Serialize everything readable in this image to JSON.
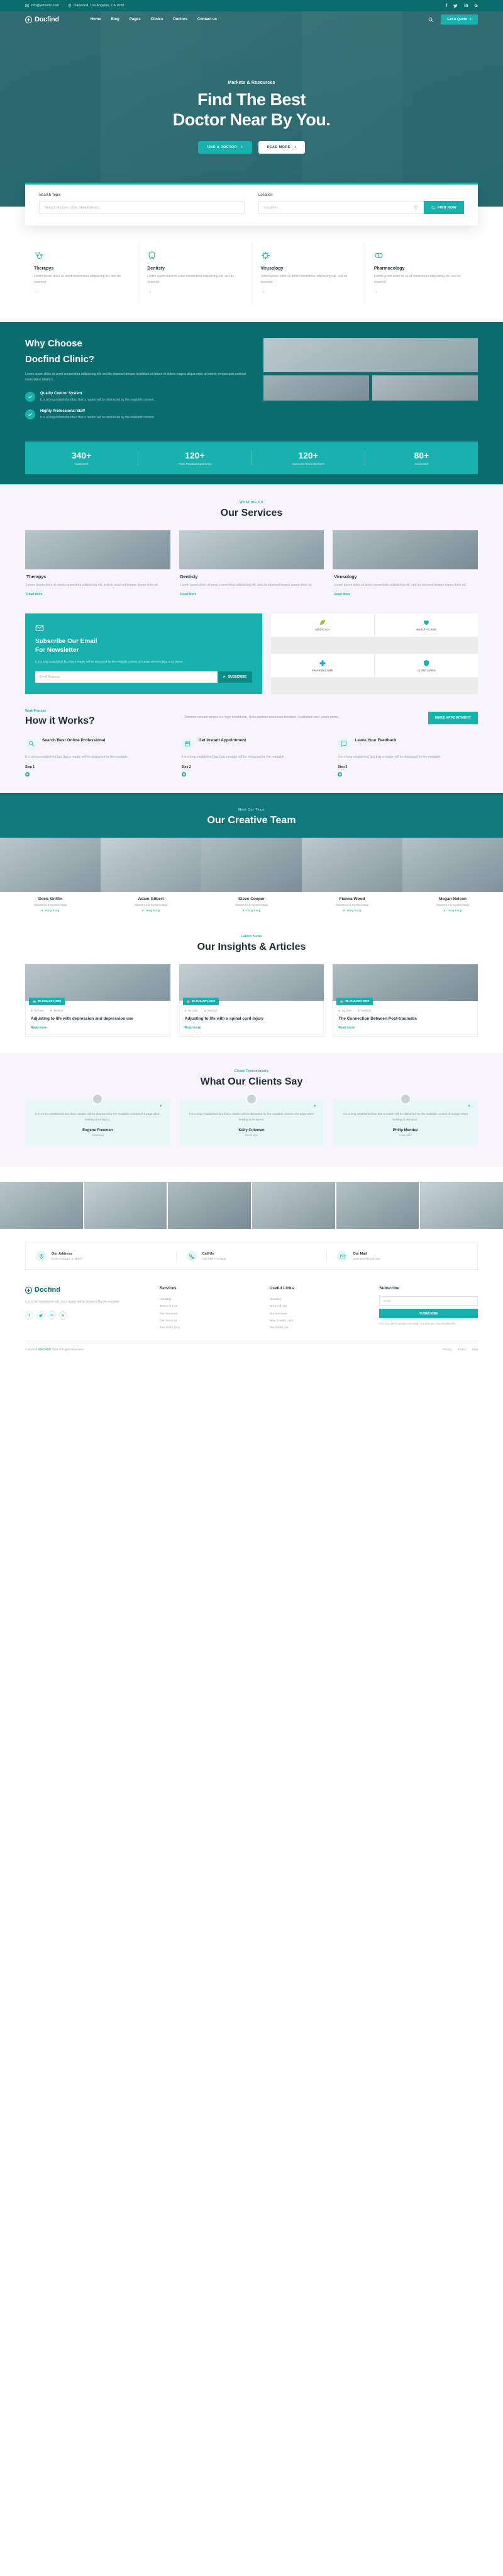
{
  "topbar": {
    "email": "info@website.com",
    "location": "Oakwood, Los Angeles, CA 1098",
    "social": [
      "f",
      "ƒ",
      "in",
      "G"
    ]
  },
  "nav": {
    "logo": "Docfind",
    "items": [
      "Home",
      "Blog",
      "Pages",
      "Clinics",
      "Doctors",
      "Contact us"
    ],
    "quote_label": "Get A Quote"
  },
  "hero": {
    "eyebrow": "Markets & Resources",
    "title_line1": "Find The Best",
    "title_line2": "Doctor Near By You.",
    "btn_primary": "FIND A DOCTOR",
    "btn_secondary": "READ MORE"
  },
  "search": {
    "label_topic": "Search Topic",
    "label_location": "Location",
    "placeholder_topic": "Search doctors, clinic, Hospitals etc.",
    "placeholder_location": "Location",
    "button": "FIND NOW"
  },
  "service_icons": [
    {
      "title": "Therapys",
      "desc": "Lorem ipsum dolor sit amet consectetur adipisicing elit, sed do eiusmod"
    },
    {
      "title": "Dentisty",
      "desc": "Lorem ipsum dolor sit amet consectetur adipisicing elit, sed do eiusmod"
    },
    {
      "title": "Virusology",
      "desc": "Lorem ipsum dolor sit amet consectetur adipisicing elit, sed do eiusmod"
    },
    {
      "title": "Pharmocology",
      "desc": "Lorem ipsum dolor sit amet consectetur adipisicing elit, sed do eiusmod"
    }
  ],
  "why": {
    "title_line1": "Why Choose",
    "title_line2": "Docfind Clinic?",
    "paragraph": "Lorem ipsum dolor sit amet consectetur adipisicing elit, sed do eiusmod tempor incididunt ut labore et dolore magna aliqua enim ad minim veniam quis nostrud exercitation ullamco.",
    "features": [
      {
        "title": "Quality Control System",
        "desc": "It is a long established fact that a reader will be distracted by the readable content."
      },
      {
        "title": "Highly Professional Staff",
        "desc": "It is a long established fact that a reader will be distracted by the readable content."
      }
    ]
  },
  "stats": [
    {
      "number": "340+",
      "label": "Customers"
    },
    {
      "number": "120+",
      "label": "Years Practical Experience"
    },
    {
      "number": "120+",
      "label": "Awesome Team Members"
    },
    {
      "number": "80+",
      "label": "Customers"
    }
  ],
  "services": {
    "eyebrow": "WHAT WE DO",
    "title": "Our Services",
    "cards": [
      {
        "title": "Therapys",
        "desc": "Lorem ipsum dolor sit amet consectetur adipisicing elit, sed do eiusmod tempor ipsum dolor sit.",
        "more": "Read More"
      },
      {
        "title": "Dentisty",
        "desc": "Lorem ipsum dolor sit amet consectetur adipisicing elit, sed do eiusmod tempor ipsum dolor sit.",
        "more": "Read More"
      },
      {
        "title": "Virusology",
        "desc": "Lorem ipsum dolor sit amet consectetur adipisicing elit, sed do eiusmod tempor ipsum dolor sit.",
        "more": "Read More"
      }
    ]
  },
  "newsletter": {
    "title_line1": "Subscribe Our Email",
    "title_line2": "For Newsletter",
    "desc": "It is a long established fact that a reader will be distracted by the readable content of a page when looking at its layout.",
    "placeholder": "Email Address",
    "button": "SUBSCRIBE",
    "brands": [
      "MEDICAL+",
      "HEALTH CARE",
      "PHARMACARE",
      "CLINIC BARN"
    ]
  },
  "how": {
    "eyebrow": "Work Process",
    "title": "How it Works?",
    "paragraph": "Dolorem nonrum tempor leo legin incididunte. Nulla partition accumsan tincidunt. Vestibulum ante ipsum primis.",
    "cta": "MAKE APPOINTMENT",
    "steps": [
      {
        "title": "Search Best Online Professional",
        "desc": "It is a long established fact that a reader will be distracted by the readable.",
        "step": "Step 1"
      },
      {
        "title": "Get Instant Appointment",
        "desc": "It is a long established fact that a reader will be distracted by the readable.",
        "step": "Step 2"
      },
      {
        "title": "Leave Your Feedback",
        "desc": "It is a long established fact that a reader will be distracted by the readable.",
        "step": "Step 3"
      }
    ]
  },
  "team": {
    "eyebrow": "Meet Our Team",
    "title": "Our Creative Team",
    "members": [
      {
        "name": "Doris Griffin",
        "role": "Obstetrics & Gynaecology",
        "location": "Hong Kong"
      },
      {
        "name": "Adam Gilbert",
        "role": "Obstetrics & Gynaecology",
        "location": "Hong Kong"
      },
      {
        "name": "Steve Cooper",
        "role": "Obstetrics & Gynaecology",
        "location": "Hong Kong"
      },
      {
        "name": "Fianna Wood",
        "role": "Obstetrics & Gynaecology",
        "location": "Hong Kong"
      },
      {
        "name": "Megan Nelson",
        "role": "Obstetrics & Gynaecology",
        "location": "Hong Kong"
      }
    ]
  },
  "blog": {
    "eyebrow": "Latest News",
    "title": "Our Insights & Articles",
    "posts": [
      {
        "date": "28 JANUARY, 2023",
        "author": "By User",
        "category": "Medical",
        "title": "Adjusting to life with depression and depression use",
        "more": "Read more"
      },
      {
        "date": "28 JANUARY, 2023",
        "author": "By User",
        "category": "Medical",
        "title": "Adjusting to life with a spinal cord injury",
        "more": "Read more"
      },
      {
        "date": "28 JANUARY, 2023",
        "author": "By User",
        "category": "Medical",
        "title": "The Connection Between Post-traumatic",
        "more": "Read more"
      }
    ]
  },
  "testimonials": {
    "eyebrow": "Client Testimonials",
    "title": "What Our Clients Say",
    "items": [
      {
        "text": "It is a long established fact that a reader will be distracted by the readable content of a page when looking at its layout.",
        "name": "Eugene Freeman",
        "role": "Treadavat"
      },
      {
        "text": "It is a long established fact that a reader will be distracted by the readable content of a page when looking at its layout.",
        "name": "Kelly Coleman",
        "role": "Nurse Res"
      },
      {
        "text": "It is a long established fact that a reader will be distracted by the readable content of a page when looking at its layout.",
        "name": "Philip Mendez",
        "role": "Consultitur"
      }
    ]
  },
  "contact": [
    {
      "label": "Our Address",
      "value": "Drive Chicago, IL 60647"
    },
    {
      "label": "Call Us",
      "value": "Call 099-773-5528"
    },
    {
      "label": "Our Mail",
      "value": "yourname@mail.com"
    }
  ],
  "footer": {
    "logo": "Docfind",
    "about": "It is a long established fact that a reader will be distracted by the readable.",
    "social": [
      "f",
      "ƒ",
      "in",
      "G"
    ],
    "columns": [
      {
        "heading": "Services",
        "links": [
          "Dentistry",
          "Terms of Use",
          "Our Services",
          "Our Services",
          "The Team List"
        ]
      },
      {
        "heading": "Useful Links",
        "links": [
          "Dentistry",
          "Terms of Use",
          "Our Services",
          "New Guests Lists",
          "The Team List"
        ]
      }
    ],
    "subscribe": {
      "heading": "Subscribe",
      "placeholder": "Email",
      "button": "SUBSCRIBE",
      "note": "Get The Latest Updates via email. Any time you may unsubscribe."
    },
    "copyright_prefix": "© docfind",
    "copyright_brand": "DOCFIND",
    "copyright_suffix": "2023 All Rights Reserved",
    "bottom_links": [
      "Privacy",
      "Terms",
      "Help"
    ]
  }
}
